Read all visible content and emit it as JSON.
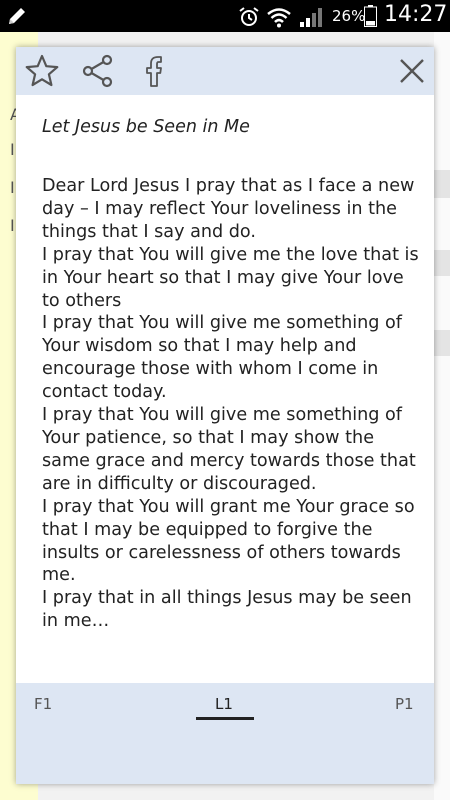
{
  "status_bar": {
    "battery_percent": "26%",
    "time": "14:27",
    "icons": [
      "pencil-icon",
      "alarm-icon",
      "wifi-icon",
      "signal-icon",
      "battery-icon"
    ]
  },
  "background": {
    "letters": [
      "A",
      "I",
      "I",
      "I"
    ]
  },
  "dialog": {
    "header_icons": [
      "star-icon",
      "share-icon",
      "facebook-icon",
      "close-icon"
    ],
    "title": "Let Jesus be Seen in Me",
    "body": "Dear Lord Jesus I pray that as I face a new day – I may reflect Your loveliness in the things that I say and do.\nI pray that You will give me the love that is in Your heart so that I may give Your love to others\nI pray that You will give me something of Your wisdom so that I may help and encourage those with whom I come in contact today.\nI pray that You will give me something of Your patience, so that I may show the same grace and mercy towards those that are in difficulty or discouraged.\nI pray that You will grant me Your grace so that I may be equipped to forgive the insults or carelessness of others towards me.\nI pray that in all things Jesus may be seen in me…"
  },
  "footer": {
    "tabs": [
      {
        "label": "F1"
      },
      {
        "label": "L1",
        "active": true
      },
      {
        "label": "P1"
      }
    ]
  },
  "colors": {
    "header_bg": "#dde6f3",
    "footer_bg": "#dde6f3",
    "status_bar_bg": "#000000",
    "background_left": "#fdfdd0"
  }
}
